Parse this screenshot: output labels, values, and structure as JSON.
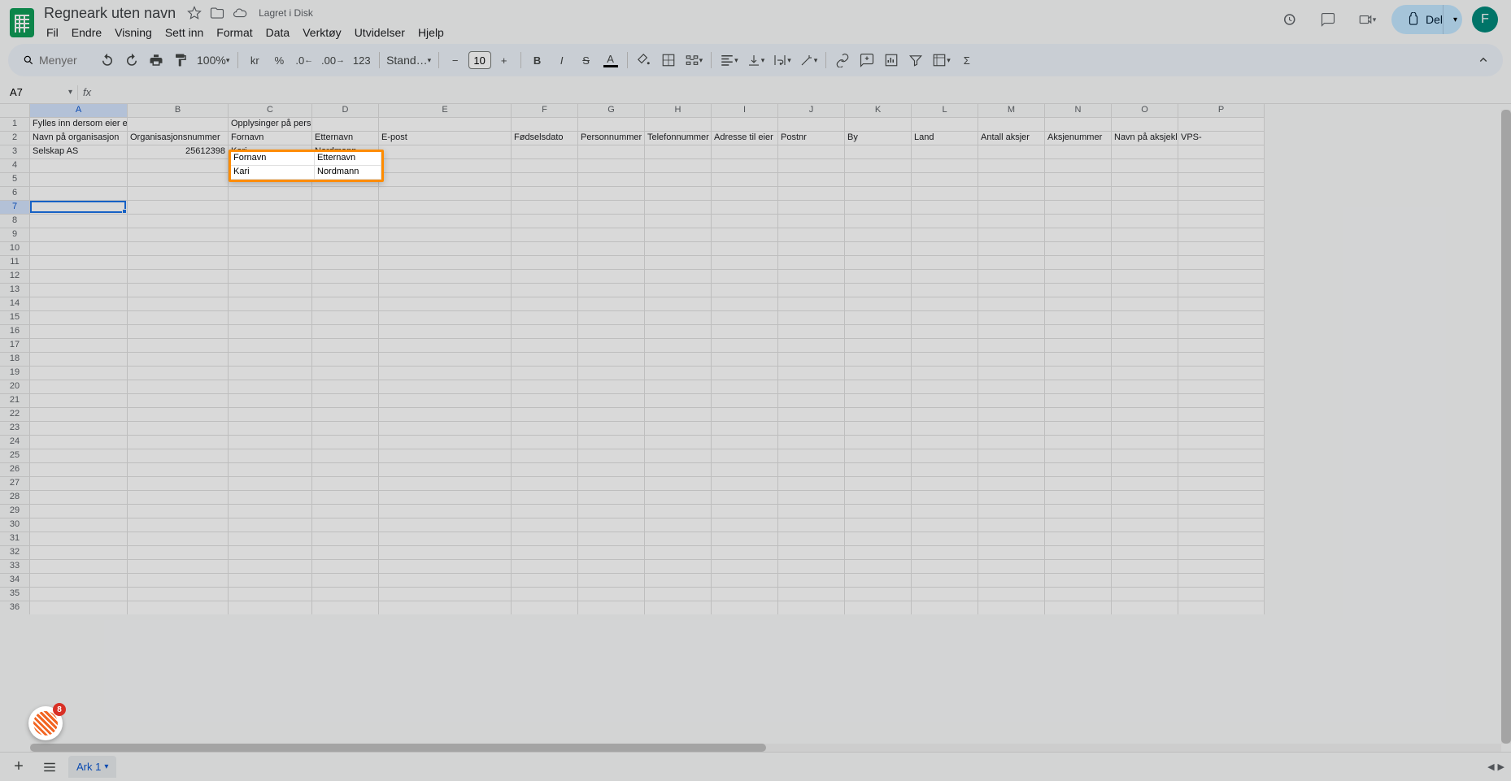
{
  "header": {
    "doc_title": "Regneark uten navn",
    "saved_label": "Lagret i Disk",
    "share_label": "Del",
    "avatar_initial": "F"
  },
  "menus": [
    "Fil",
    "Endre",
    "Visning",
    "Sett inn",
    "Format",
    "Data",
    "Verktøy",
    "Utvidelser",
    "Hjelp"
  ],
  "toolbar": {
    "search_placeholder": "Menyer",
    "zoom": "100%",
    "currency": "kr",
    "percent": "%",
    "num_fmt": "123",
    "font_name": "Stand…",
    "font_size": "10"
  },
  "namebox": {
    "cell_ref": "A7"
  },
  "columns": [
    "A",
    "B",
    "C",
    "D",
    "E",
    "F",
    "G",
    "H",
    "I",
    "J",
    "K",
    "L",
    "M",
    "N",
    "O",
    "P"
  ],
  "row_count": 36,
  "cells": {
    "r1": {
      "A": "Fylles inn dersom eier er en organisasjon",
      "C": "Opplysinger på personlig eier eller kontaktperson"
    },
    "r2": {
      "A": "Navn på organisasjon",
      "B": "Organisasjonsnummer",
      "C": "Fornavn",
      "D": "Etternavn",
      "E": "E-post",
      "F": "Fødselsdato",
      "G": "Personnummer",
      "H": "Telefonnummer",
      "I": "Adresse til eier",
      "J": "Postnr",
      "K": "By",
      "L": "Land",
      "M": "Antall aksjer",
      "N": "Aksjenummer",
      "O": "Navn på aksjeklasse",
      "P": "VPS-"
    },
    "r3": {
      "A": "Selskap AS",
      "B": "25612398",
      "C": "Kari",
      "D": "Nordmann"
    }
  },
  "highlight": {
    "c_label": "Fornavn",
    "d_label": "Etternavn",
    "c_val": "Kari",
    "d_val": "Nordmann"
  },
  "bottom": {
    "sheet_name": "Ark 1"
  },
  "badge_count": "8"
}
